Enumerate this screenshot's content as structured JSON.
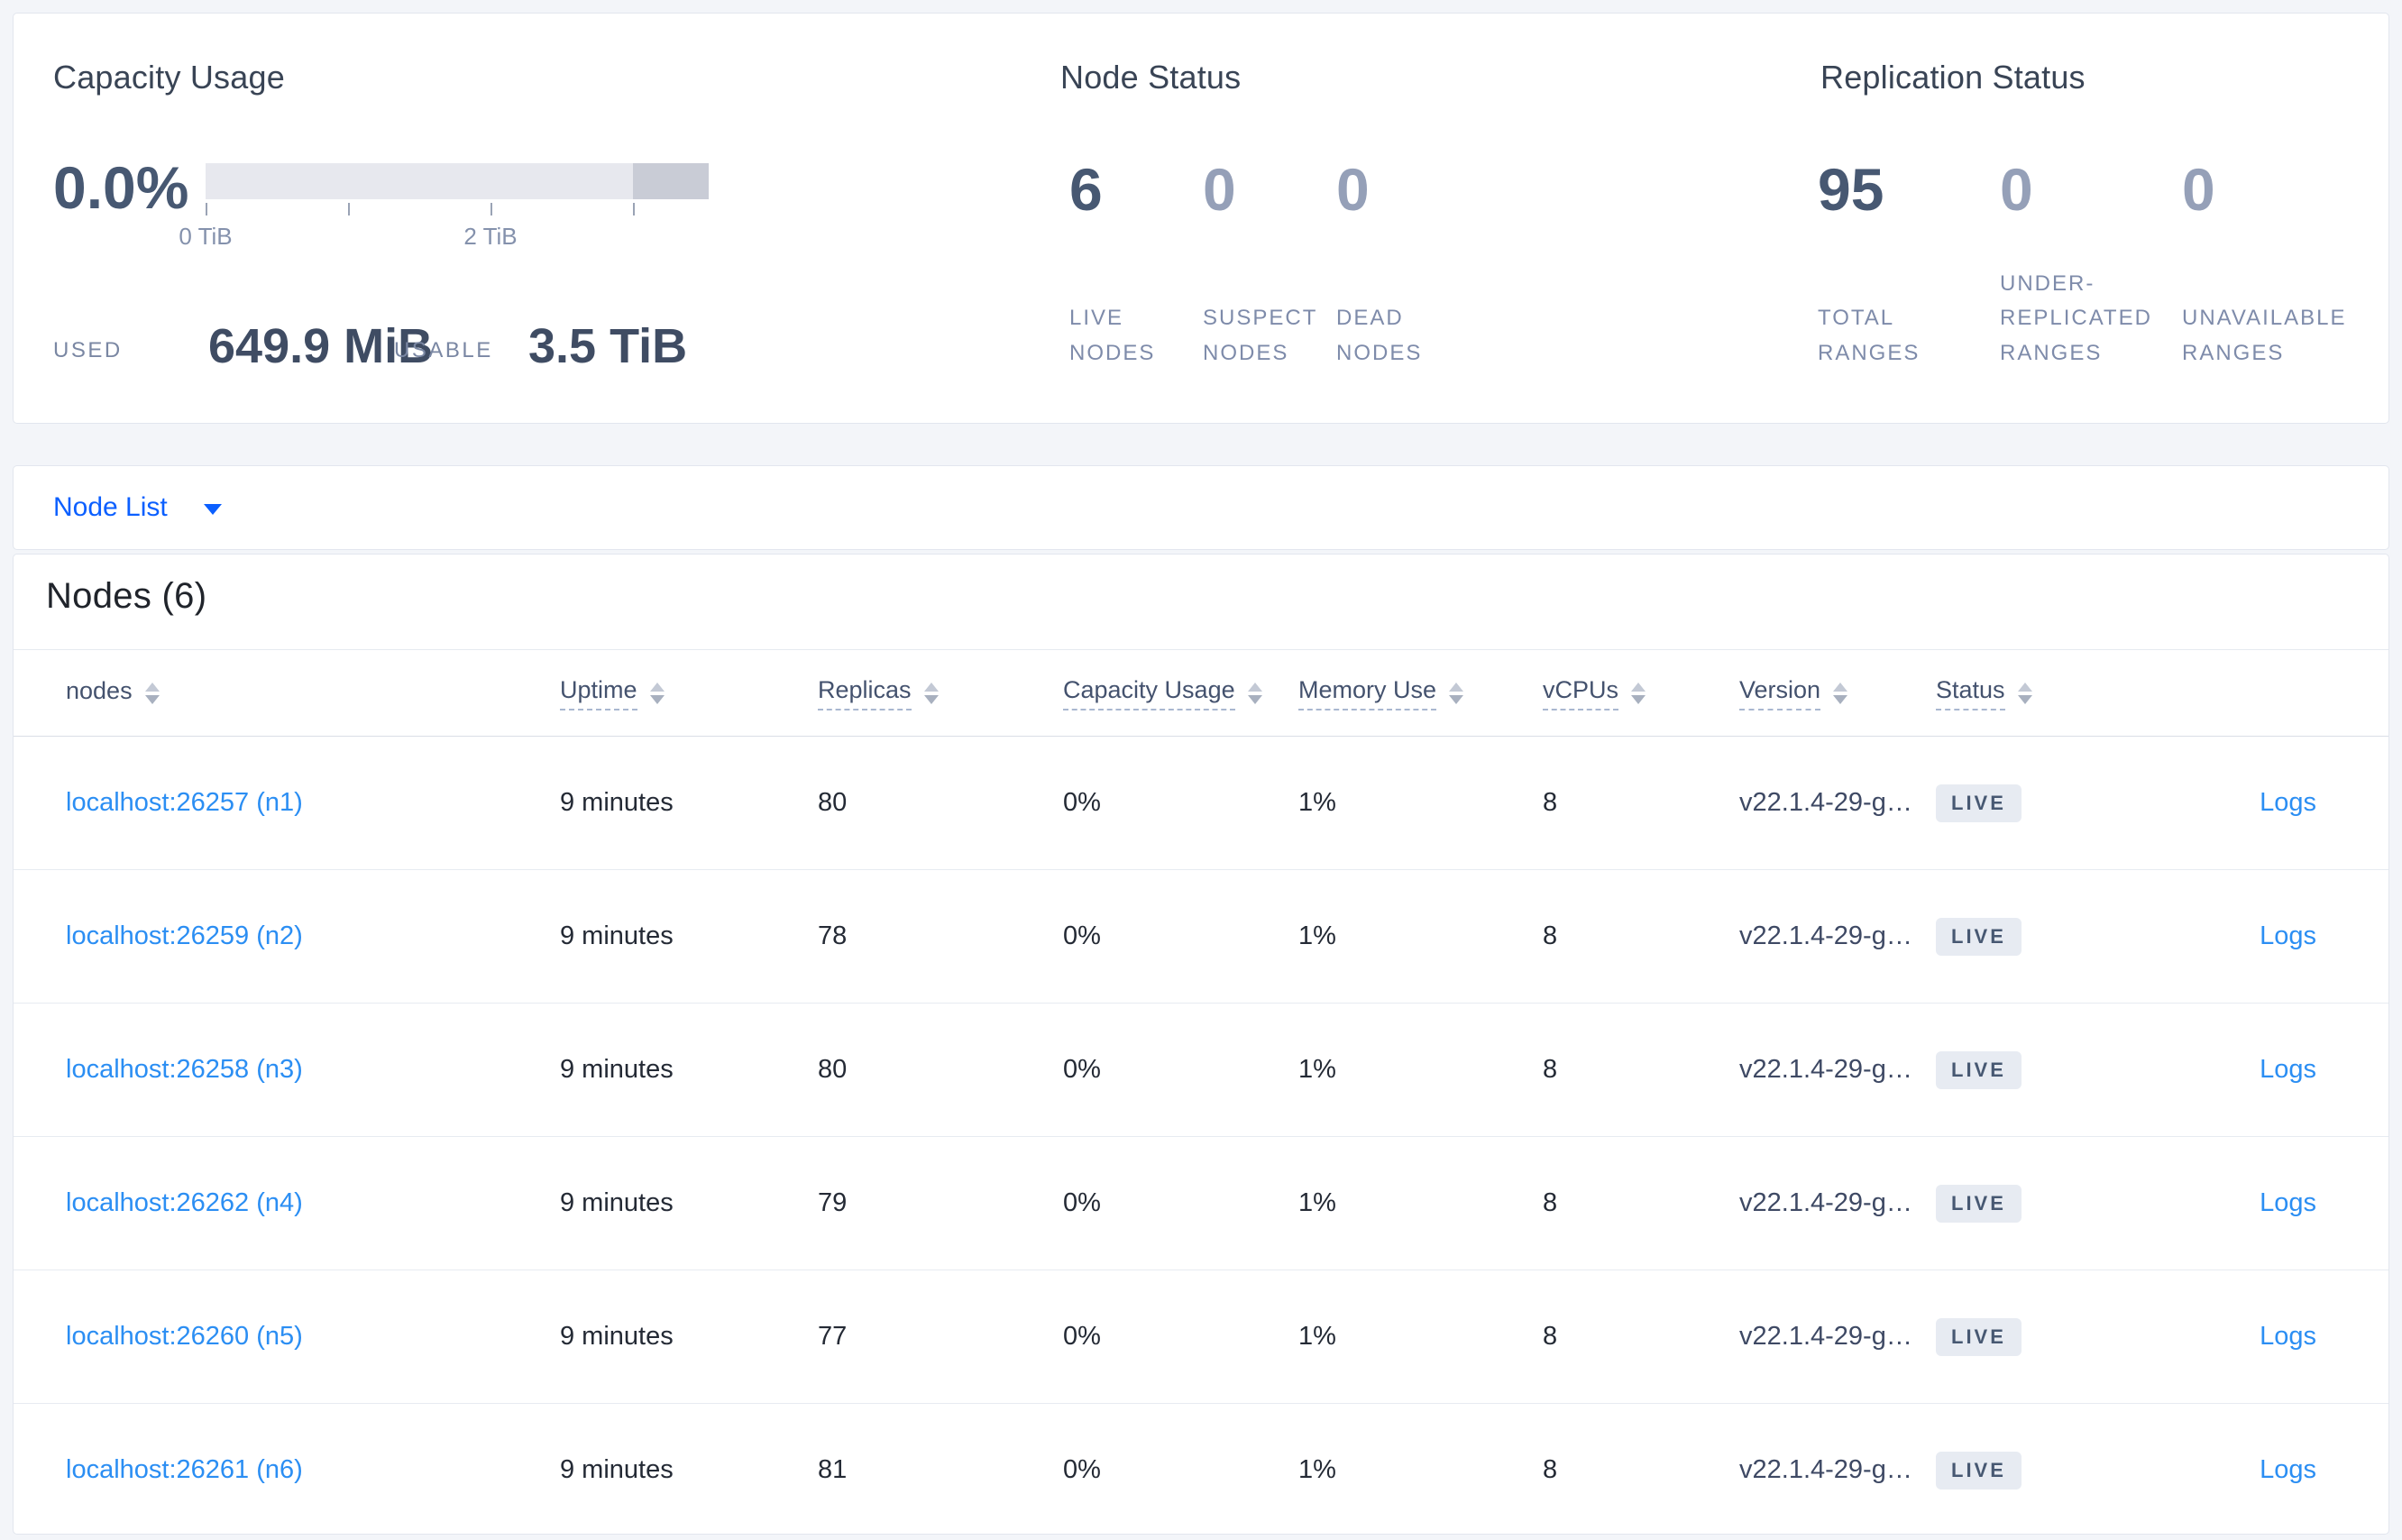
{
  "summary": {
    "capacity": {
      "title": "Capacity Usage",
      "percent": "0.0%",
      "axis_tick_labels": [
        "0 TiB",
        "2 TiB"
      ],
      "used_label": "USED",
      "used_value": "649.9 MiB",
      "usable_label": "USABLE",
      "usable_value": "3.5 TiB",
      "bar_base_color": "#e7e8ee",
      "bar_dark_color": "#c9ccd6"
    },
    "node_status": {
      "title": "Node Status",
      "metrics": [
        {
          "value": "6",
          "label": "LIVE NODES",
          "emphasized": true
        },
        {
          "value": "0",
          "label": "SUSPECT NODES",
          "emphasized": false
        },
        {
          "value": "0",
          "label": "DEAD NODES",
          "emphasized": false
        }
      ]
    },
    "replication_status": {
      "title": "Replication Status",
      "metrics": [
        {
          "value": "95",
          "label": "TOTAL RANGES",
          "emphasized": true
        },
        {
          "value": "0",
          "label": "UNDER-REPLICATED RANGES",
          "emphasized": false
        },
        {
          "value": "0",
          "label": "UNAVAILABLE RANGES",
          "emphasized": false
        }
      ]
    }
  },
  "view_selector": {
    "label": "Node List",
    "icon": "caret-down"
  },
  "nodes_table": {
    "title": "Nodes (6)",
    "columns": [
      {
        "label": "nodes",
        "underlined": false
      },
      {
        "label": "Uptime",
        "underlined": true
      },
      {
        "label": "Replicas",
        "underlined": true
      },
      {
        "label": "Capacity Usage",
        "underlined": true
      },
      {
        "label": "Memory Use",
        "underlined": true
      },
      {
        "label": "vCPUs",
        "underlined": true
      },
      {
        "label": "Version",
        "underlined": true
      },
      {
        "label": "Status",
        "underlined": true
      }
    ],
    "rows": [
      {
        "node": "localhost:26257 (n1)",
        "uptime": "9 minutes",
        "replicas": "80",
        "capacity_usage": "0%",
        "memory_use": "1%",
        "vcpus": "8",
        "version": "v22.1.4-29-g…",
        "status": "LIVE",
        "logs_label": "Logs"
      },
      {
        "node": "localhost:26259 (n2)",
        "uptime": "9 minutes",
        "replicas": "78",
        "capacity_usage": "0%",
        "memory_use": "1%",
        "vcpus": "8",
        "version": "v22.1.4-29-g…",
        "status": "LIVE",
        "logs_label": "Logs"
      },
      {
        "node": "localhost:26258 (n3)",
        "uptime": "9 minutes",
        "replicas": "80",
        "capacity_usage": "0%",
        "memory_use": "1%",
        "vcpus": "8",
        "version": "v22.1.4-29-g…",
        "status": "LIVE",
        "logs_label": "Logs"
      },
      {
        "node": "localhost:26262 (n4)",
        "uptime": "9 minutes",
        "replicas": "79",
        "capacity_usage": "0%",
        "memory_use": "1%",
        "vcpus": "8",
        "version": "v22.1.4-29-g…",
        "status": "LIVE",
        "logs_label": "Logs"
      },
      {
        "node": "localhost:26260 (n5)",
        "uptime": "9 minutes",
        "replicas": "77",
        "capacity_usage": "0%",
        "memory_use": "1%",
        "vcpus": "8",
        "version": "v22.1.4-29-g…",
        "status": "LIVE",
        "logs_label": "Logs"
      },
      {
        "node": "localhost:26261 (n6)",
        "uptime": "9 minutes",
        "replicas": "81",
        "capacity_usage": "0%",
        "memory_use": "1%",
        "vcpus": "8",
        "version": "v22.1.4-29-g…",
        "status": "LIVE",
        "logs_label": "Logs"
      }
    ]
  },
  "colors": {
    "accent_blue": "#0b5fff",
    "link_blue": "#2b8ef3",
    "badge_background": "#e7ebf2",
    "badge_text": "#475872",
    "page_background": "#f3f5f9"
  }
}
